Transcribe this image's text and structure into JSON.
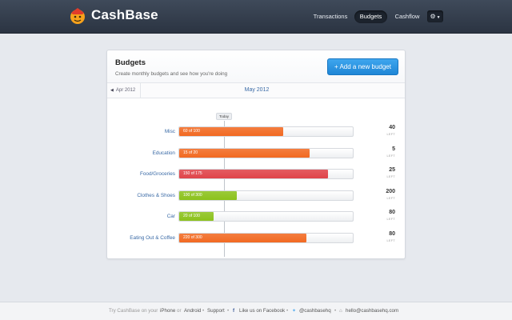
{
  "header": {
    "brand": "CashBase",
    "nav": [
      {
        "label": "Transactions",
        "active": false
      },
      {
        "label": "Budgets",
        "active": true
      },
      {
        "label": "Cashflow",
        "active": false
      }
    ],
    "settings_icon": "gear-icon"
  },
  "card": {
    "title": "Budgets",
    "subtitle": "Create monthly budgets and see how you're doing",
    "add_button": "+ Add a new budget",
    "prev_month": "Apr 2012",
    "current_month": "May 2012",
    "today_label": "Today",
    "left_label": "LEFT"
  },
  "budgets": [
    {
      "category": "Misc",
      "progress_text": "60 of 100",
      "spent": 60,
      "total": 100,
      "left": "40",
      "color": "#f26a22"
    },
    {
      "category": "Education",
      "progress_text": "15 of 20",
      "spent": 15,
      "total": 20,
      "left": "5",
      "color": "#f26a22"
    },
    {
      "category": "Food/Groceries",
      "progress_text": "150 of 175",
      "spent": 150,
      "total": 175,
      "left": "25",
      "color": "#e0444a"
    },
    {
      "category": "Clothes & Shoes",
      "progress_text": "100 of 300",
      "spent": 100,
      "total": 300,
      "left": "200",
      "color": "#8cc21c"
    },
    {
      "category": "Car",
      "progress_text": "20 of 100",
      "spent": 20,
      "total": 100,
      "left": "80",
      "color": "#8cc21c"
    },
    {
      "category": "Eating Out & Coffee",
      "progress_text": "220 of 300",
      "spent": 220,
      "total": 300,
      "left": "80",
      "color": "#f26a22"
    }
  ],
  "footer": {
    "try_text": "Try CashBase on your",
    "iphone": "iPhone",
    "or": "or",
    "android": "Android",
    "support": "Support",
    "facebook": "Like us on Facebook",
    "twitter": "@cashbasehq",
    "email": "hello@cashbasehq.com"
  }
}
